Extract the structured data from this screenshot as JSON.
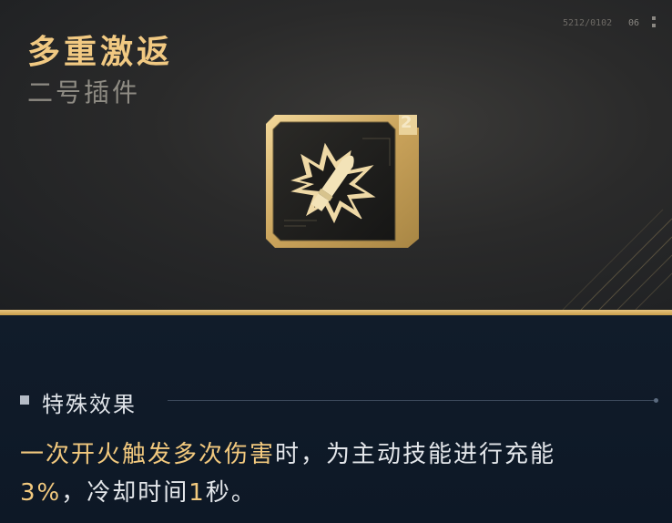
{
  "item": {
    "name": "多重激返",
    "type": "二号插件",
    "slot_number": "2",
    "icon": "bullet-burst-icon"
  },
  "header_codes": {
    "serial": "5212/0102",
    "tag": "06"
  },
  "effect": {
    "section_title": "特殊效果",
    "segments": [
      {
        "text": "一次开火触发多次伤害",
        "highlight": true
      },
      {
        "text": "时，为主动技能进行充能",
        "highlight": false
      },
      {
        "text": "3%",
        "highlight": true
      },
      {
        "text": "，冷却时间",
        "highlight": false
      },
      {
        "text": "1",
        "highlight": true
      },
      {
        "text": "秒。",
        "highlight": false
      }
    ]
  },
  "colors": {
    "gold": "#f1c982",
    "highlight": "#f2c97e",
    "panel_bg": "#0f1a28"
  }
}
